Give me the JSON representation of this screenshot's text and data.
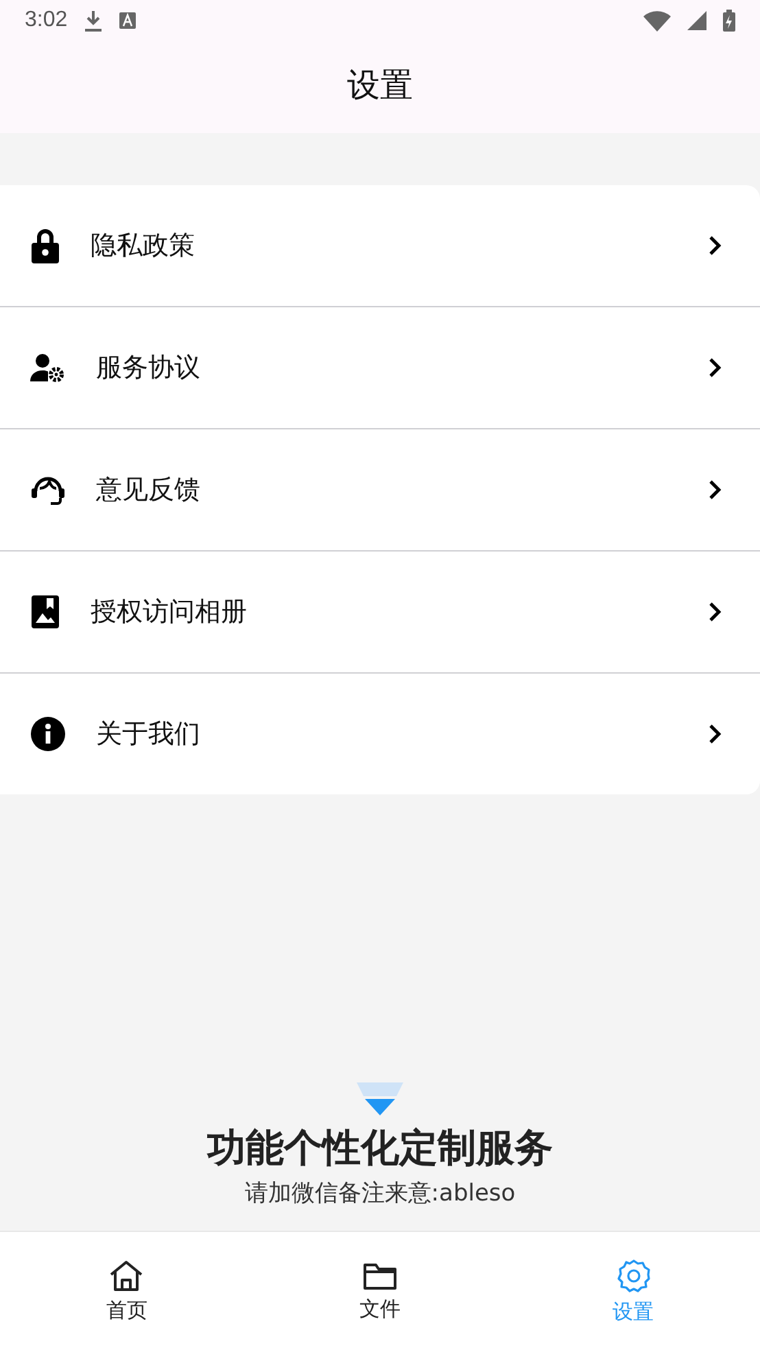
{
  "status_bar": {
    "time": "3:02"
  },
  "header": {
    "title": "设置"
  },
  "menu": [
    {
      "label": "隐私政策"
    },
    {
      "label": "服务协议"
    },
    {
      "label": "意见反馈"
    },
    {
      "label": "授权访问相册"
    },
    {
      "label": "关于我们"
    }
  ],
  "promo": {
    "title": "功能个性化定制服务",
    "subtitle": "请加微信备注来意:ableso"
  },
  "bottom_nav": [
    {
      "label": "首页",
      "selected": false
    },
    {
      "label": "文件",
      "selected": false
    },
    {
      "label": "设置",
      "selected": true
    }
  ]
}
